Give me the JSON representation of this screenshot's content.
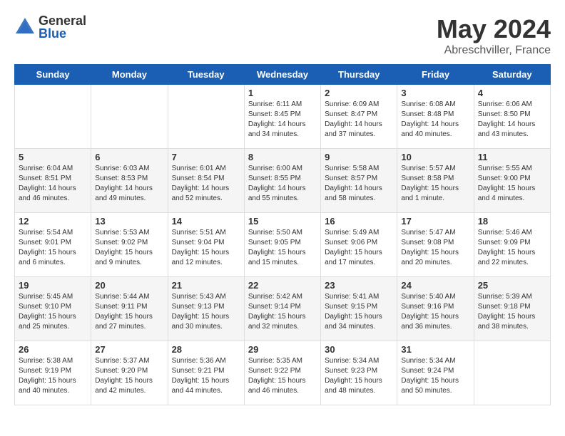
{
  "logo": {
    "general": "General",
    "blue": "Blue"
  },
  "title": "May 2024",
  "subtitle": "Abreschviller, France",
  "headers": [
    "Sunday",
    "Monday",
    "Tuesday",
    "Wednesday",
    "Thursday",
    "Friday",
    "Saturday"
  ],
  "weeks": [
    [
      {
        "day": "",
        "info": ""
      },
      {
        "day": "",
        "info": ""
      },
      {
        "day": "",
        "info": ""
      },
      {
        "day": "1",
        "info": "Sunrise: 6:11 AM\nSunset: 8:45 PM\nDaylight: 14 hours\nand 34 minutes."
      },
      {
        "day": "2",
        "info": "Sunrise: 6:09 AM\nSunset: 8:47 PM\nDaylight: 14 hours\nand 37 minutes."
      },
      {
        "day": "3",
        "info": "Sunrise: 6:08 AM\nSunset: 8:48 PM\nDaylight: 14 hours\nand 40 minutes."
      },
      {
        "day": "4",
        "info": "Sunrise: 6:06 AM\nSunset: 8:50 PM\nDaylight: 14 hours\nand 43 minutes."
      }
    ],
    [
      {
        "day": "5",
        "info": "Sunrise: 6:04 AM\nSunset: 8:51 PM\nDaylight: 14 hours\nand 46 minutes."
      },
      {
        "day": "6",
        "info": "Sunrise: 6:03 AM\nSunset: 8:53 PM\nDaylight: 14 hours\nand 49 minutes."
      },
      {
        "day": "7",
        "info": "Sunrise: 6:01 AM\nSunset: 8:54 PM\nDaylight: 14 hours\nand 52 minutes."
      },
      {
        "day": "8",
        "info": "Sunrise: 6:00 AM\nSunset: 8:55 PM\nDaylight: 14 hours\nand 55 minutes."
      },
      {
        "day": "9",
        "info": "Sunrise: 5:58 AM\nSunset: 8:57 PM\nDaylight: 14 hours\nand 58 minutes."
      },
      {
        "day": "10",
        "info": "Sunrise: 5:57 AM\nSunset: 8:58 PM\nDaylight: 15 hours\nand 1 minute."
      },
      {
        "day": "11",
        "info": "Sunrise: 5:55 AM\nSunset: 9:00 PM\nDaylight: 15 hours\nand 4 minutes."
      }
    ],
    [
      {
        "day": "12",
        "info": "Sunrise: 5:54 AM\nSunset: 9:01 PM\nDaylight: 15 hours\nand 6 minutes."
      },
      {
        "day": "13",
        "info": "Sunrise: 5:53 AM\nSunset: 9:02 PM\nDaylight: 15 hours\nand 9 minutes."
      },
      {
        "day": "14",
        "info": "Sunrise: 5:51 AM\nSunset: 9:04 PM\nDaylight: 15 hours\nand 12 minutes."
      },
      {
        "day": "15",
        "info": "Sunrise: 5:50 AM\nSunset: 9:05 PM\nDaylight: 15 hours\nand 15 minutes."
      },
      {
        "day": "16",
        "info": "Sunrise: 5:49 AM\nSunset: 9:06 PM\nDaylight: 15 hours\nand 17 minutes."
      },
      {
        "day": "17",
        "info": "Sunrise: 5:47 AM\nSunset: 9:08 PM\nDaylight: 15 hours\nand 20 minutes."
      },
      {
        "day": "18",
        "info": "Sunrise: 5:46 AM\nSunset: 9:09 PM\nDaylight: 15 hours\nand 22 minutes."
      }
    ],
    [
      {
        "day": "19",
        "info": "Sunrise: 5:45 AM\nSunset: 9:10 PM\nDaylight: 15 hours\nand 25 minutes."
      },
      {
        "day": "20",
        "info": "Sunrise: 5:44 AM\nSunset: 9:11 PM\nDaylight: 15 hours\nand 27 minutes."
      },
      {
        "day": "21",
        "info": "Sunrise: 5:43 AM\nSunset: 9:13 PM\nDaylight: 15 hours\nand 30 minutes."
      },
      {
        "day": "22",
        "info": "Sunrise: 5:42 AM\nSunset: 9:14 PM\nDaylight: 15 hours\nand 32 minutes."
      },
      {
        "day": "23",
        "info": "Sunrise: 5:41 AM\nSunset: 9:15 PM\nDaylight: 15 hours\nand 34 minutes."
      },
      {
        "day": "24",
        "info": "Sunrise: 5:40 AM\nSunset: 9:16 PM\nDaylight: 15 hours\nand 36 minutes."
      },
      {
        "day": "25",
        "info": "Sunrise: 5:39 AM\nSunset: 9:18 PM\nDaylight: 15 hours\nand 38 minutes."
      }
    ],
    [
      {
        "day": "26",
        "info": "Sunrise: 5:38 AM\nSunset: 9:19 PM\nDaylight: 15 hours\nand 40 minutes."
      },
      {
        "day": "27",
        "info": "Sunrise: 5:37 AM\nSunset: 9:20 PM\nDaylight: 15 hours\nand 42 minutes."
      },
      {
        "day": "28",
        "info": "Sunrise: 5:36 AM\nSunset: 9:21 PM\nDaylight: 15 hours\nand 44 minutes."
      },
      {
        "day": "29",
        "info": "Sunrise: 5:35 AM\nSunset: 9:22 PM\nDaylight: 15 hours\nand 46 minutes."
      },
      {
        "day": "30",
        "info": "Sunrise: 5:34 AM\nSunset: 9:23 PM\nDaylight: 15 hours\nand 48 minutes."
      },
      {
        "day": "31",
        "info": "Sunrise: 5:34 AM\nSunset: 9:24 PM\nDaylight: 15 hours\nand 50 minutes."
      },
      {
        "day": "",
        "info": ""
      }
    ]
  ]
}
